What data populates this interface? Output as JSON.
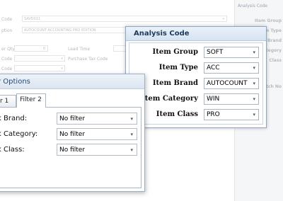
{
  "background_form": {
    "fields": [
      {
        "label": "Code",
        "value": "SAVD011",
        "y": 22
      },
      {
        "label": "ption",
        "value": "AUTOCOUNT ACCOUNTING PRO EDITION",
        "y": 38
      }
    ],
    "order_qty_label": "er Qty",
    "order_qty_value": "0",
    "lead_time_label": "Lead Time",
    "tax_code_label": "Code",
    "purchase_tax_label": "Purchase Tax Code",
    "code_label_2": "Code"
  },
  "side_panel": {
    "header": "Analysis Code",
    "labels": [
      "Item Group",
      "Item Type",
      "Item Brand",
      "Category",
      "Class",
      "Batch No"
    ]
  },
  "analysis_dialog": {
    "title": "Analysis Code",
    "rows": [
      {
        "label": "Item Group",
        "value": "SOFT"
      },
      {
        "label": "Item Type",
        "value": "ACC"
      },
      {
        "label": "Item Brand",
        "value": "AUTOCOUNT"
      },
      {
        "label": "Item Category",
        "value": "WIN"
      },
      {
        "label": "Item Class",
        "value": "PRO"
      }
    ]
  },
  "filter_dialog": {
    "title": "r Options",
    "tabs": [
      {
        "label": "r 1",
        "active": false
      },
      {
        "label": "Filter 2",
        "active": true
      }
    ],
    "rows": [
      {
        "label": "k Brand:",
        "value": "No filter"
      },
      {
        "label": "k Category:",
        "value": "No filter"
      },
      {
        "label": "k Class:",
        "value": "No filter"
      }
    ]
  },
  "icons": {
    "dropdown": "chevron-down-icon"
  }
}
